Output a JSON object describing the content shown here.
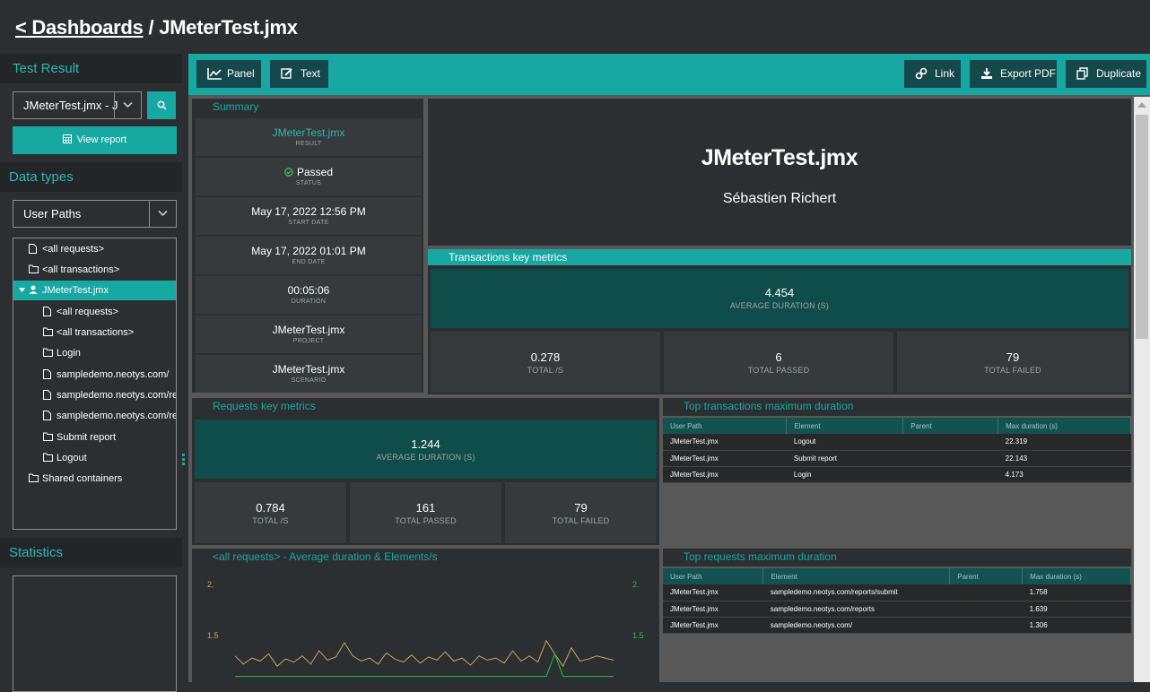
{
  "breadcrumb": {
    "back_label": "< Dashboards",
    "separator": "/",
    "current": "JMeterTest.jmx"
  },
  "sidebar": {
    "test_result_title": "Test Result",
    "test_select_value": "JMeterTest.jmx - J",
    "view_report_label": "View report",
    "data_types_title": "Data types",
    "data_type_select_value": "User Paths",
    "tree": [
      {
        "label": "<all requests>",
        "icon": "file-icon"
      },
      {
        "label": "<all transactions>",
        "icon": "folder-icon"
      },
      {
        "label": "JMeterTest.jmx",
        "icon": "user-icon",
        "selected": true
      },
      {
        "label": "<all requests>",
        "icon": "file-icon"
      },
      {
        "label": "<all transactions>",
        "icon": "folder-icon"
      },
      {
        "label": "Login",
        "icon": "folder-icon"
      },
      {
        "label": "sampledemo.neotys.com/",
        "icon": "file-icon"
      },
      {
        "label": "sampledemo.neotys.com/rep",
        "icon": "file-icon"
      },
      {
        "label": "sampledemo.neotys.com/rep",
        "icon": "file-icon"
      },
      {
        "label": "Submit report",
        "icon": "folder-icon"
      },
      {
        "label": "Logout",
        "icon": "folder-icon"
      },
      {
        "label": "Shared containers",
        "icon": "folder-icon"
      }
    ],
    "statistics_title": "Statistics"
  },
  "toolbar": {
    "panel_label": "Panel",
    "text_label": "Text",
    "link_label": "Link",
    "export_label": "Export PDF",
    "duplicate_label": "Duplicate"
  },
  "summary": {
    "title": "Summary",
    "rows": [
      {
        "value": "JMeterTest.jmx",
        "label": "RESULT"
      },
      {
        "value": "Passed",
        "label": "STATUS"
      },
      {
        "value": "May 17, 2022 12:56 PM",
        "label": "START DATE"
      },
      {
        "value": "May 17, 2022 01:01 PM",
        "label": "END DATE"
      },
      {
        "value": "00:05:06",
        "label": "DURATION"
      },
      {
        "value": "JMeterTest.jmx",
        "label": "PROJECT"
      },
      {
        "value": "JMeterTest.jmx",
        "label": "SCENARIO"
      }
    ]
  },
  "header_panel": {
    "title": "JMeterTest.jmx",
    "author": "Sébastien Richert"
  },
  "transactions_metrics": {
    "title": "Transactions key metrics",
    "avg": {
      "value": "4.454",
      "label": "AVERAGE DURATION (S)"
    },
    "total_per_s": {
      "value": "0.278",
      "label": "TOTAL /S"
    },
    "passed": {
      "value": "6",
      "label": "TOTAL PASSED"
    },
    "failed": {
      "value": "79",
      "label": "TOTAL FAILED"
    }
  },
  "requests_metrics": {
    "title": "Requests key metrics",
    "avg": {
      "value": "1.244",
      "label": "AVERAGE DURATION (S)"
    },
    "total_per_s": {
      "value": "0.784",
      "label": "TOTAL /S"
    },
    "passed": {
      "value": "161",
      "label": "TOTAL PASSED"
    },
    "failed": {
      "value": "79",
      "label": "TOTAL FAILED"
    }
  },
  "top_transactions": {
    "title": "Top transactions maximum duration",
    "columns": [
      "User Path",
      "Element",
      "Parent",
      "Max duration (s)"
    ],
    "rows": [
      [
        "JMeterTest.jmx",
        "Logout",
        "",
        "22.319"
      ],
      [
        "JMeterTest.jmx",
        "Submit report",
        "",
        "22.143"
      ],
      [
        "JMeterTest.jmx",
        "Login",
        "",
        "4.173"
      ]
    ]
  },
  "top_requests": {
    "title": "Top requests maximum duration",
    "columns": [
      "User Path",
      "Element",
      "Parent",
      "Max duration (s)"
    ],
    "rows": [
      [
        "JMeterTest.jmx",
        "sampledemo.neotys.com/reports/submit",
        "",
        "1.758"
      ],
      [
        "JMeterTest.jmx",
        "sampledemo.neotys.com/reports",
        "",
        "1.639"
      ],
      [
        "JMeterTest.jmx",
        "sampledemo.neotys.com/",
        "",
        "1.306"
      ]
    ]
  },
  "chart_data": {
    "type": "line",
    "title": "<all requests> - Average duration & Elements/s",
    "ytick_labels_left": [
      "2.",
      "1.5"
    ],
    "ytick_labels_right": [
      "2.",
      "1.5"
    ],
    "ylim": [
      1.2,
      2.0
    ],
    "series": [
      {
        "color": "#c9a55a",
        "values": [
          1.3,
          1.22,
          1.28,
          1.25,
          1.32,
          1.2,
          1.27,
          1.24,
          1.3,
          1.22,
          1.35,
          1.26,
          1.29,
          1.43,
          1.3,
          1.25,
          1.28,
          1.22,
          1.33,
          1.27,
          1.24,
          1.31,
          1.23,
          1.29,
          1.26,
          1.34,
          1.25,
          1.28,
          1.21,
          1.3,
          1.26,
          1.28,
          1.23,
          1.35,
          1.25,
          1.3,
          1.24,
          1.45,
          1.32,
          1.2,
          1.38,
          1.25,
          1.27,
          1.3,
          1.28,
          1.26
        ]
      },
      {
        "color": "#22c23a",
        "values": [
          1.1,
          1.1,
          1.1,
          1.1,
          1.1,
          1.1,
          1.1,
          1.1,
          1.1,
          1.1,
          1.1,
          1.1,
          1.1,
          1.1,
          1.1,
          1.1,
          1.1,
          1.1,
          1.1,
          1.1,
          1.1,
          1.1,
          1.1,
          1.1,
          1.1,
          1.1,
          1.1,
          1.1,
          1.1,
          1.1,
          1.1,
          1.1,
          1.1,
          1.1,
          1.1,
          1.1,
          1.1,
          1.1,
          1.32,
          1.1,
          1.1,
          1.1,
          1.1,
          1.1,
          1.1,
          1.1
        ]
      }
    ]
  },
  "colors": {
    "accent": "#17a8a1",
    "dark_teal": "#0f4d4a",
    "panel": "#2c2f31",
    "status_ok": "#3fbf4f"
  }
}
